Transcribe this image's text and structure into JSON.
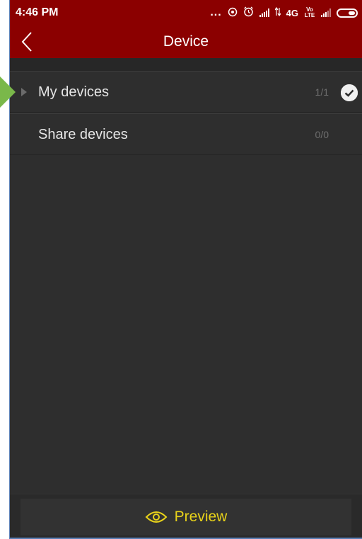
{
  "status_bar": {
    "time": "4:46 PM",
    "dots": "...",
    "network": "4G",
    "volte": "Vo LTE"
  },
  "header": {
    "title": "Device",
    "back_icon": "chevron-left-icon",
    "background": "#8b0000"
  },
  "devices": {
    "items": [
      {
        "label": "My devices",
        "count": "1/1",
        "checked": true,
        "icon": "triangle-right-icon"
      },
      {
        "label": "Share devices",
        "count": "0/0",
        "checked": false
      }
    ]
  },
  "footer": {
    "preview_label": "Preview",
    "preview_icon": "eye-icon",
    "accent": "#e8d21a"
  }
}
